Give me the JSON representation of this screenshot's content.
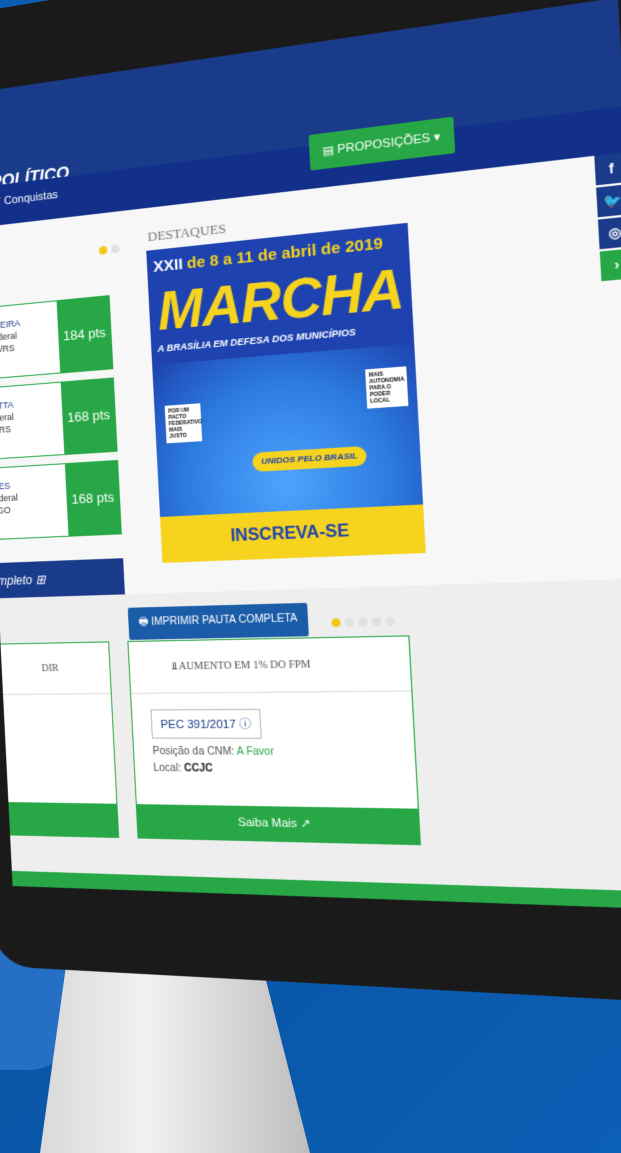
{
  "header": {
    "brand_title": "POLÍTICO",
    "nav_conquistas": "Conquistas",
    "proposicoes_button": "PROPOSIÇÕES"
  },
  "social": [
    "f",
    "🐦",
    "◎",
    "›"
  ],
  "ranking": [
    {
      "name": "MOREIRA",
      "role": "o Federal",
      "party": "MDB/RS",
      "points": "184 pts"
    },
    {
      "name": "MOTTA",
      "role": "Federal",
      "party": "DT/RS",
      "points": "168 pts"
    },
    {
      "name": "AVES",
      "role": "Federal",
      "party": "B/GO",
      "points": "168 pts"
    }
  ],
  "ranking_more": "mpleto",
  "destaques": {
    "label": "DESTAQUES",
    "banner": {
      "edition": "XXII",
      "dates": "de 8 a 11 de abril de 2019",
      "title": "MARCHA",
      "subtitle": "A BRASÍLIA EM DEFESA DOS MUNICÍPIOS",
      "crowd_sign": "UNIDOS PELO BRASIL",
      "sign_1": "POR UM PACTO FEDERATIVO MAIS JUSTO",
      "sign_2": "MAIS AUTONOMIA PARA O PODER LOCAL",
      "cta": "INSCREVA-SE"
    }
  },
  "pauta": {
    "print_button": "IMPRIMIR PAUTA COMPLETA",
    "cards": [
      {
        "title": "DIR",
        "more": ""
      },
      {
        "title": "AUMENTO EM 1% DO FPM",
        "badge": "PEC 391/2017",
        "position_label": "Posição da CNM:",
        "position_value": "A Favor",
        "local_label": "Local:",
        "local_value": "CCJC",
        "more": "Saiba Mais"
      }
    ]
  }
}
